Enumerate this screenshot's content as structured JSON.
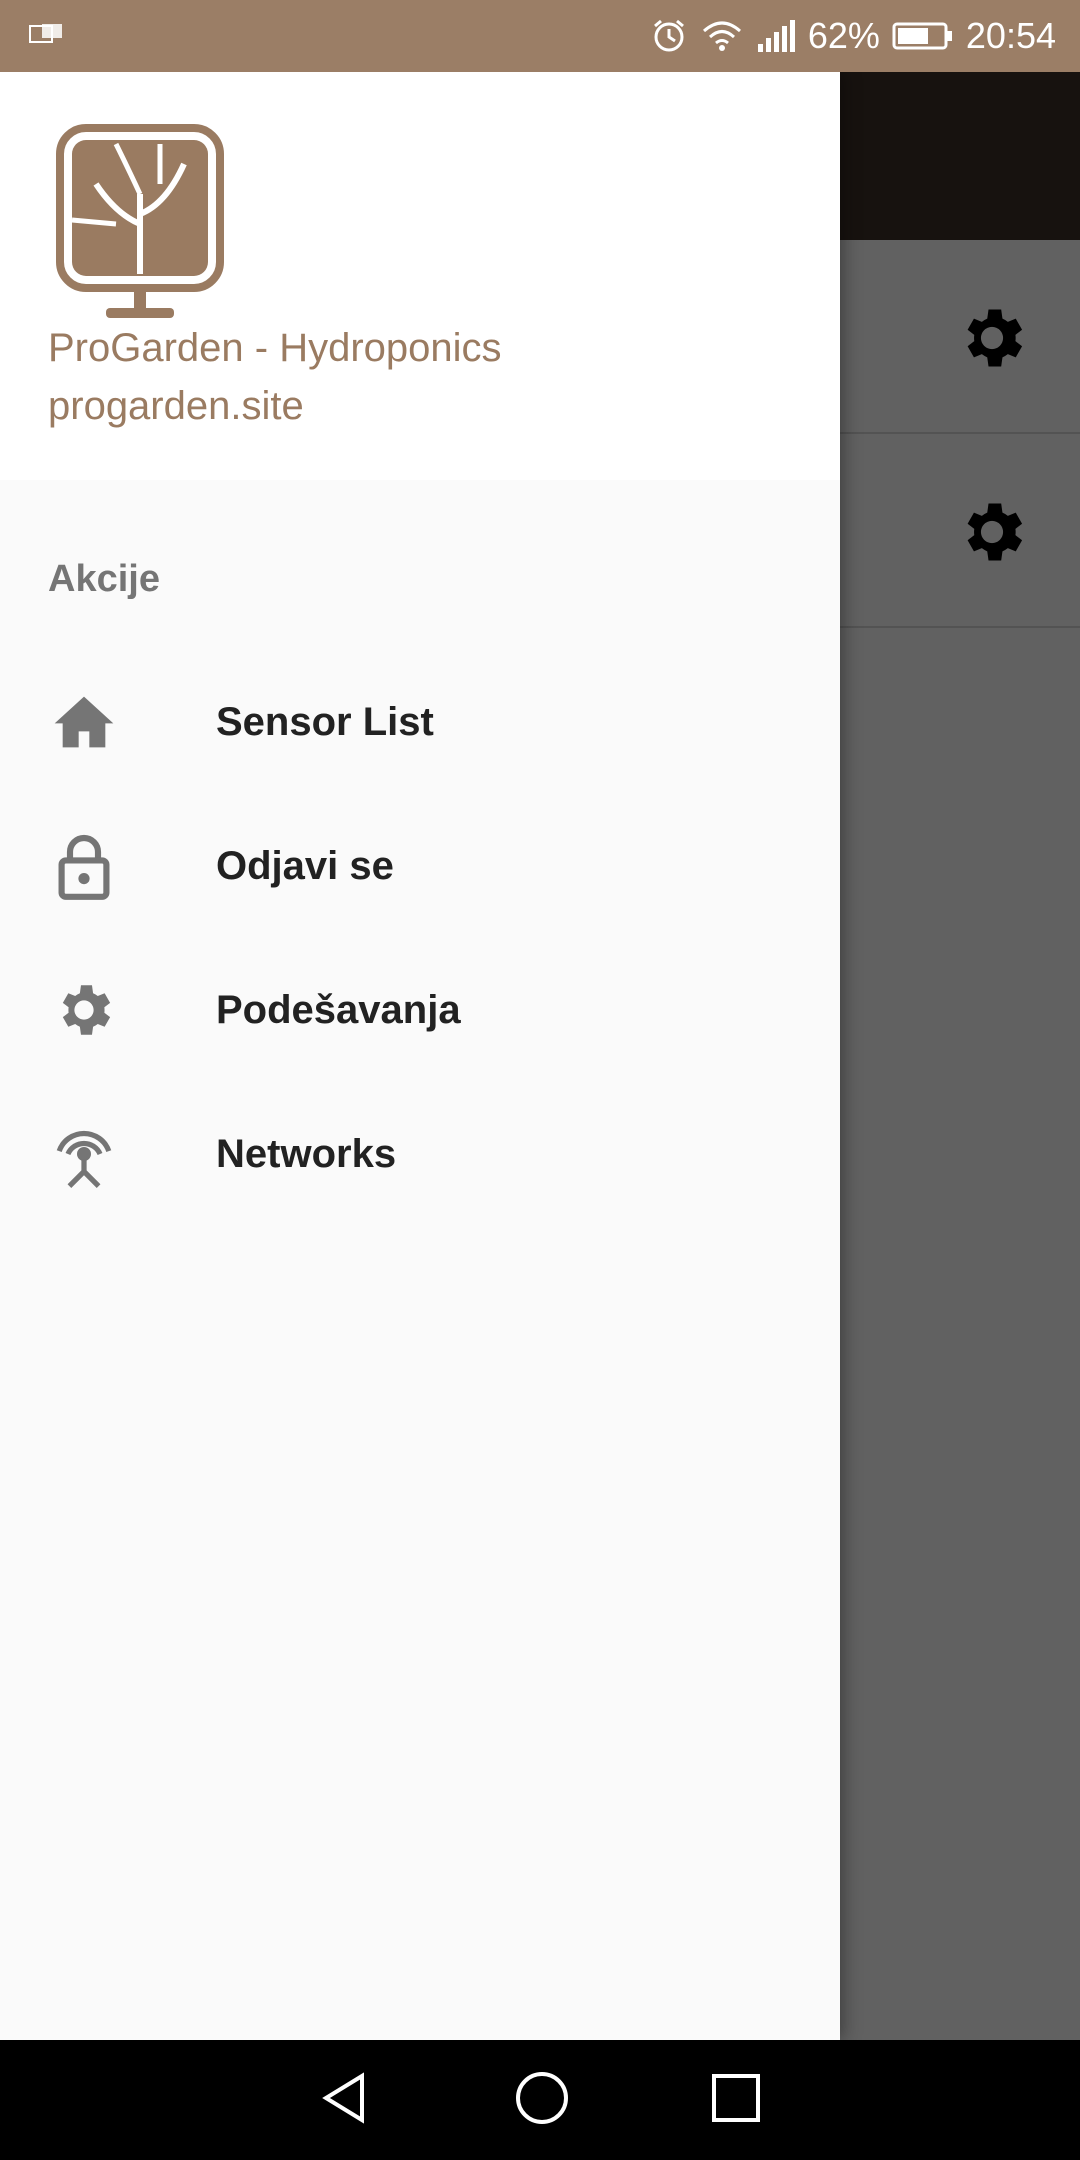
{
  "status_bar": {
    "battery_percent": "62%",
    "time": "20:54",
    "icons": [
      "notification-icon",
      "alarm-icon",
      "wifi-icon",
      "signal-icon",
      "battery-icon"
    ]
  },
  "drawer": {
    "app_name": "ProGarden - Hydroponics",
    "app_site": "progarden.site",
    "section_title": "Akcije",
    "items": [
      {
        "label": "Sensor List",
        "icon": "home-icon"
      },
      {
        "label": "Odjavi se",
        "icon": "lock-icon"
      },
      {
        "label": "Podešavanja",
        "icon": "gear-icon"
      },
      {
        "label": "Networks",
        "icon": "antenna-icon"
      }
    ]
  },
  "background_app": {
    "row_icons": [
      "gear-icon",
      "gear-icon"
    ]
  },
  "nav_bar": {
    "buttons": [
      "back-icon",
      "home-circle-icon",
      "recents-icon"
    ]
  },
  "colors": {
    "status_bar": "#9b7e66",
    "accent_brown": "#9a7b61",
    "toolbar": "#3a2f27",
    "menu_icon": "#757575"
  }
}
